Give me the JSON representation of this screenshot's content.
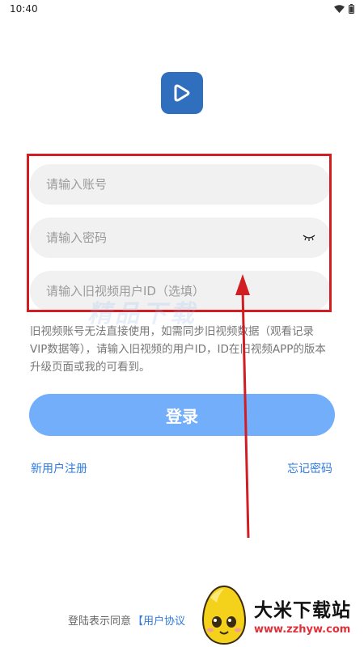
{
  "status_bar": {
    "time": "10:40",
    "icons": [
      "wifi-icon",
      "battery-icon"
    ]
  },
  "app": {
    "logo_icon": "play-icon",
    "brand_color": "#2f6fbd"
  },
  "form": {
    "account": {
      "placeholder": "请输入账号",
      "value": ""
    },
    "password": {
      "placeholder": "请输入密码",
      "value": "",
      "toggle_icon": "eye-closed-icon"
    },
    "old_user_id": {
      "placeholder": "请输入旧视频用户ID（选填）",
      "value": ""
    },
    "hint": "旧视频账号无法直接使用，如需同步旧视频数据（观看记录 VIP数据等），请输入旧视频的用户ID，ID在旧视频APP的版本升级页面或我的可看到。"
  },
  "login_button": {
    "label": "登录",
    "color": "#73aefb"
  },
  "links": {
    "register": "新用户注册",
    "forgot_password": "忘记密码"
  },
  "agreement": {
    "prefix": "登陆表示同意",
    "link": "【用户协议"
  },
  "overlay": {
    "highlight_color": "#d01e23",
    "watermark": "精品下载",
    "brand_name": "大米下载站",
    "brand_url": "www.zzhyw.com"
  }
}
